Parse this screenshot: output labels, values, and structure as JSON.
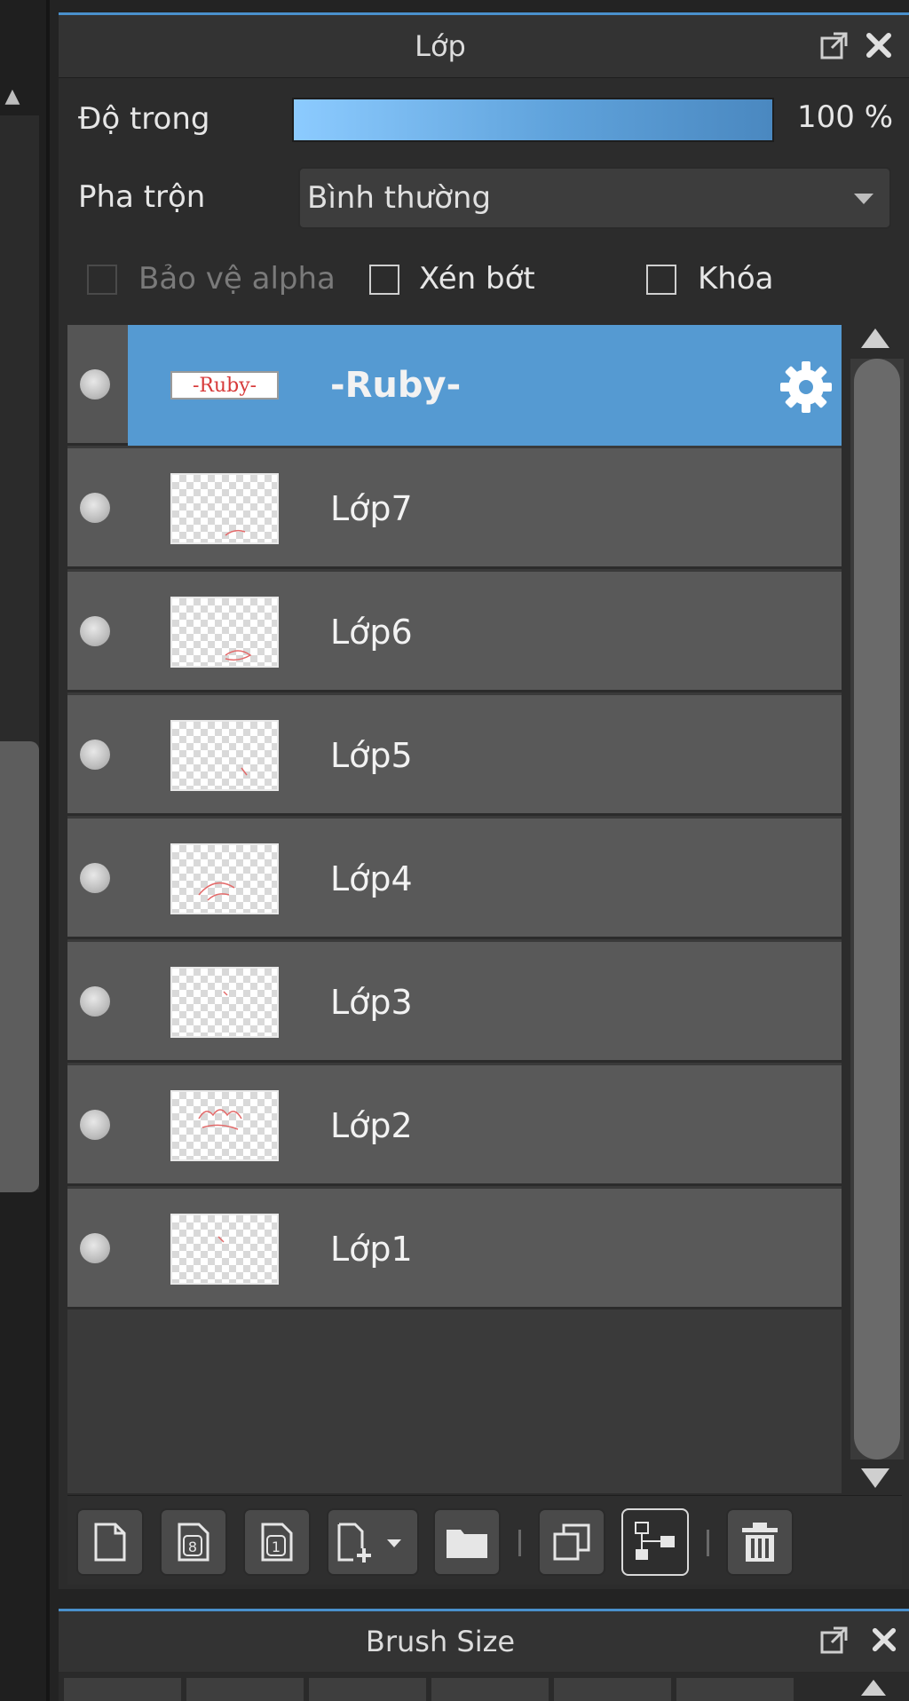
{
  "layers_panel": {
    "title": "Lớp",
    "opacity": {
      "label": "Độ trong",
      "value": "100 %",
      "fraction": 1.0
    },
    "blend": {
      "label": "Pha trộn",
      "value": "Bình thường"
    },
    "checkboxes": {
      "protect_alpha": {
        "label": "Bảo vệ alpha",
        "checked": false,
        "enabled": false
      },
      "clipping": {
        "label": "Xén bớt",
        "checked": false,
        "enabled": true
      },
      "lock": {
        "label": "Khóa",
        "checked": false,
        "enabled": true
      }
    },
    "layers": [
      {
        "name": "-Ruby-",
        "thumb_text": "-Ruby-",
        "selected": true
      },
      {
        "name": "Lớp7",
        "selected": false
      },
      {
        "name": "Lớp6",
        "selected": false
      },
      {
        "name": "Lớp5",
        "selected": false
      },
      {
        "name": "Lớp4",
        "selected": false
      },
      {
        "name": "Lớp3",
        "selected": false
      },
      {
        "name": "Lớp2",
        "selected": false
      },
      {
        "name": "Lớp1",
        "selected": false
      }
    ],
    "toolbar": [
      {
        "icon": "new-layer-icon"
      },
      {
        "icon": "new-8bit-layer-icon",
        "glyph": "8"
      },
      {
        "icon": "new-1bit-layer-icon",
        "glyph": "1"
      },
      {
        "icon": "add-layer-dropdown-icon"
      },
      {
        "icon": "folder-icon"
      },
      {
        "icon": "duplicate-layer-icon"
      },
      {
        "icon": "merge-down-icon"
      },
      {
        "icon": "trash-icon"
      }
    ]
  },
  "brush_panel": {
    "title": "Brush Size"
  },
  "colors": {
    "accent": "#4a90cc",
    "selection": "#559ad2",
    "row": "#595959"
  }
}
